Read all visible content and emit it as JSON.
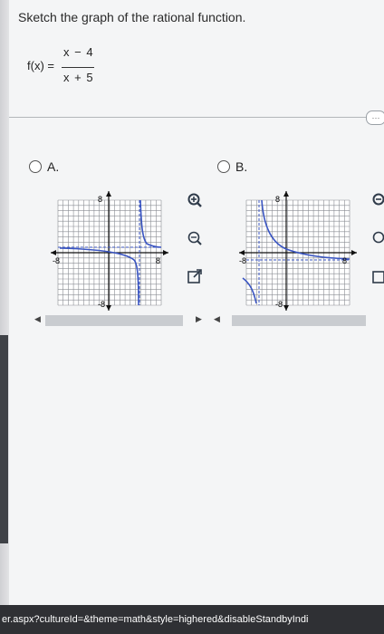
{
  "question": {
    "title": "Sketch the graph of the rational function.",
    "fx_label": "f(x) =",
    "numerator": "x − 4",
    "denominator": "x + 5"
  },
  "options": [
    {
      "label": "A.",
      "tick_pos": "8",
      "tick_neg": "-8"
    },
    {
      "label": "B.",
      "tick_pos": "8",
      "tick_neg": "-8"
    }
  ],
  "icons": {
    "zoom_in": "zoom-in-icon",
    "zoom_out": "zoom-out-icon",
    "popout": "popout-icon",
    "scroll_left": "scroll-left-icon",
    "scroll_right": "scroll-right-icon"
  },
  "colors": {
    "curve": "#3a55c2",
    "grid": "#8a8d93",
    "axis": "#111111"
  },
  "browser": {
    "url_fragment": "er.aspx?cultureId=&theme=math&style=highered&disableStandbyIndi"
  }
}
